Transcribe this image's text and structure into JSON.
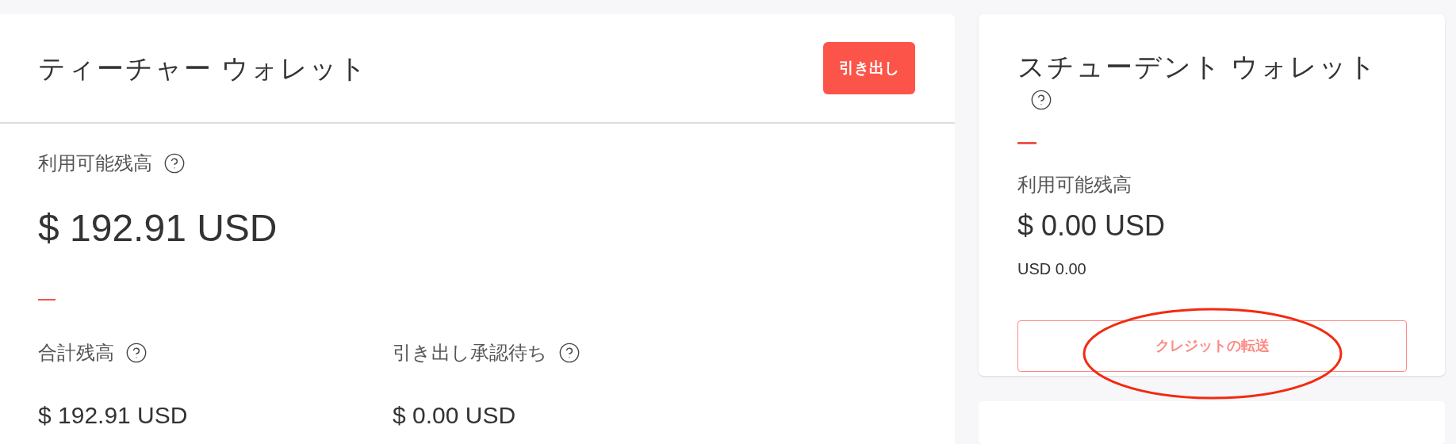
{
  "teacher_wallet": {
    "title": "ティーチャー ウォレット",
    "withdraw_button": "引き出し",
    "available": {
      "label": "利用可能残高",
      "help": true,
      "amount": "$ 192.91 USD"
    },
    "stats": [
      {
        "label": "合計残高",
        "help": true,
        "amount": "$ 192.91 USD"
      },
      {
        "label": "引き出し承認待ち",
        "help": true,
        "amount": "$ 0.00 USD"
      }
    ]
  },
  "student_wallet": {
    "title": "スチューデント ウォレット",
    "help": true,
    "available": {
      "label": "利用可能残高",
      "amount": "$ 0.00 USD",
      "sub_amount": "USD 0.00"
    },
    "transfer_button": {
      "label": "クレジットの転送",
      "highlighted": true
    }
  }
}
